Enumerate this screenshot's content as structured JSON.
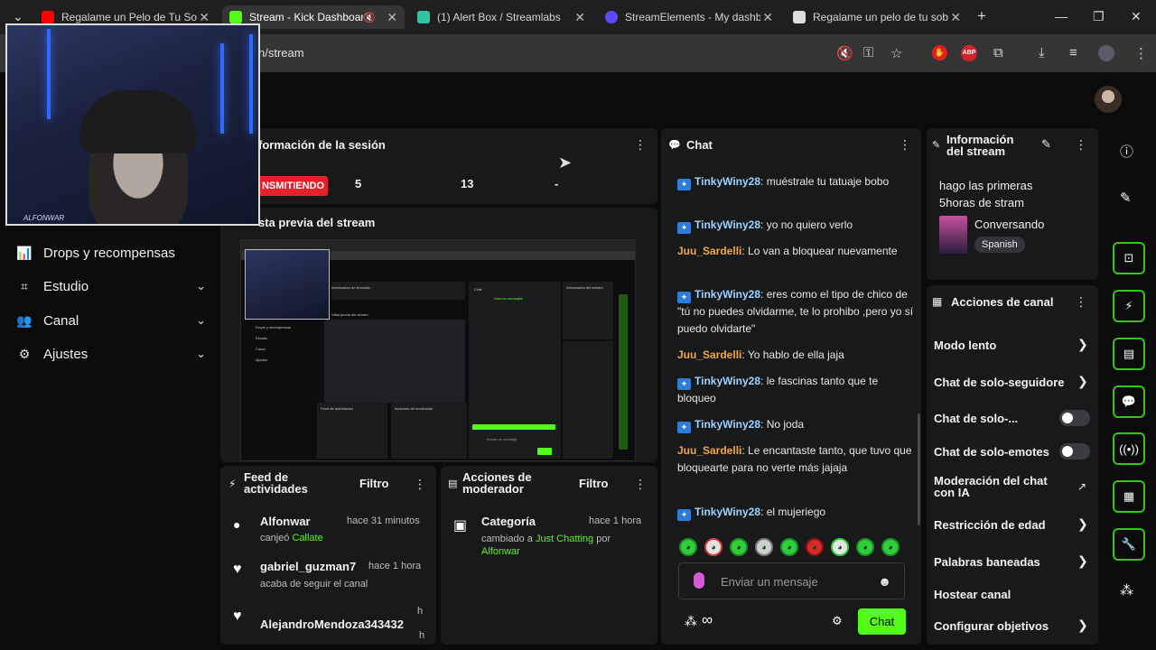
{
  "browser": {
    "tabs": [
      {
        "title": "Regalame un Pelo de Tu Sob",
        "icon": "youtube-icon",
        "color": "#ff0000"
      },
      {
        "title": "Stream - Kick Dashboard",
        "icon": "kick-icon",
        "color": "#53fc18"
      },
      {
        "title": "(1) Alert Box / Streamlabs",
        "icon": "streamlabs-icon",
        "color": "#31c3a2"
      },
      {
        "title": "StreamElements - My dashb",
        "icon": "streamelements-icon",
        "color": "#5a4bff"
      },
      {
        "title": "Regalame un pelo de tu sob",
        "icon": "page-icon",
        "color": "#dddddd"
      }
    ],
    "url": "n/stream",
    "abp": "ABP"
  },
  "webcam": {
    "signature": "ALFONWAR"
  },
  "sidebar": {
    "items": [
      {
        "label": "Drops y recompensas",
        "icon": "chart-icon",
        "chevron": false
      },
      {
        "label": "Estudio",
        "icon": "studio-icon",
        "chevron": true
      },
      {
        "label": "Canal",
        "icon": "users-icon",
        "chevron": true
      },
      {
        "label": "Ajustes",
        "icon": "gear-icon",
        "chevron": true
      }
    ]
  },
  "session": {
    "title": "formación de la sesión",
    "live_label": "NSMITIENDO",
    "stat1": "5",
    "stat2": "13",
    "stat3": "-"
  },
  "preview": {
    "title": "sta previa del stream"
  },
  "feed": {
    "title_line1": "Feed de",
    "title_line2": "actividades",
    "filter": "Filtro",
    "items": [
      {
        "name": "Alfonwar",
        "time": "hace 31 minutos",
        "sub_prefix": "canjeó",
        "sub_highlight": "Callate"
      },
      {
        "name": "gabriel_guzman7",
        "time": "hace 1 hora",
        "sub": "acaba de seguir el canal"
      },
      {
        "name": "AlejandroMendoza343432",
        "time_top": "h",
        "time_bottom": "h"
      }
    ]
  },
  "mod": {
    "title_line1": "Acciones de",
    "title_line2": "moderador",
    "filter": "Filtro",
    "item": {
      "name": "Categoría",
      "time": "hace 1 hora",
      "sub_prefix": "cambiado a",
      "sub_highlight": "Just Chatting",
      "sub_mid": "por",
      "sub_user": "Alfonwar"
    }
  },
  "chat": {
    "title": "Chat",
    "messages": [
      {
        "user": "TinkyWiny28",
        "type": "blue",
        "text": "muéstrale tu tatuaje bobo"
      },
      {
        "user": "TinkyWiny28",
        "type": "blue",
        "text": "yo no quiero verlo"
      },
      {
        "user": "Juu_Sardelli",
        "type": "orange",
        "text": "Lo van a bloquear nuevamente"
      },
      {
        "user": "TinkyWiny28",
        "type": "blue",
        "text": "eres como el tipo de chico de \"tú no puedes olvidarme, te lo prohibo ,pero yo sí puedo olvidarte\""
      },
      {
        "user": "Juu_Sardelli",
        "type": "orange",
        "text": "Yo hablo de ella jaja"
      },
      {
        "user": "TinkyWiny28",
        "type": "blue",
        "text": "le fascinas tanto que te bloqueo"
      },
      {
        "user": "TinkyWiny28",
        "type": "blue",
        "text": "No joda"
      },
      {
        "user": "Juu_Sardelli",
        "type": "orange",
        "text": "Le encantaste tanto, que tuvo que bloquearte para no verte más jajaja"
      },
      {
        "user": "TinkyWiny28",
        "type": "blue",
        "text": "el mujeriego"
      }
    ],
    "input_placeholder": "Enviar un mensaje",
    "send_label": "Chat",
    "infinity": "∞"
  },
  "stream_info": {
    "title_line1": "Información",
    "title_line2": "del stream",
    "stream_title_line1": "hago las primeras",
    "stream_title_line2": "5horas de stram",
    "category": "Conversando",
    "language": "Spanish"
  },
  "channel_actions": {
    "title": "Acciones de canal",
    "items": [
      {
        "label": "Modo lento",
        "control": "chevron"
      },
      {
        "label": "Chat de solo-seguidore",
        "control": "chevron"
      },
      {
        "label": "Chat de solo-...",
        "control": "toggle"
      },
      {
        "label": "Chat de solo-emotes",
        "control": "toggle"
      },
      {
        "label": "Moderación del chat con IA",
        "control": "external"
      },
      {
        "label": "Restricción de edad",
        "control": "chevron"
      },
      {
        "label": "Palabras baneadas",
        "control": "chevron"
      },
      {
        "label": "Hostear canal",
        "control": "none"
      },
      {
        "label": "Configurar objetivos",
        "control": "chevron"
      }
    ]
  },
  "preview_text": {
    "session": "Información de la sesión",
    "stream_preview": "Vista previa del stream",
    "drops": "Drops y recompensas",
    "studio": "Estudio",
    "channel": "Canal",
    "settings": "Ajustes",
    "chat": "Chat",
    "new_msgs": "Nuevos mensajes",
    "info": "Información del stream",
    "feed": "Feed de actividades",
    "mod": "Acciones de moderador",
    "send": "Enviar un mensaje"
  }
}
